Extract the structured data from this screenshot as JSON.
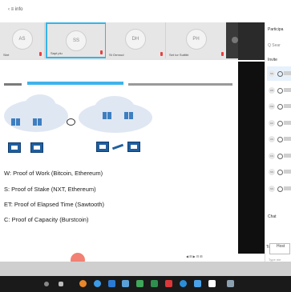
{
  "topbar": {
    "label": "‹ ≡ info"
  },
  "strip": {
    "tiles": [
      {
        "initials": "AS",
        "name": "Sbrt"
      },
      {
        "initials": "SS",
        "name": "Sapt plu"
      },
      {
        "initials": "DH",
        "name": "St Ormrud"
      },
      {
        "initials": "PH",
        "name": "Set Ior Suttlbt"
      }
    ]
  },
  "slide": {
    "lines": [
      "W: Proof of Work (Bitcoin, Ethereum)",
      "S: Proof of Stake (NXT, Ethereum)",
      "ET: Proof of Elapsed Time (Sawtooth)",
      "C: Proof of Capacity (Burstcoin)"
    ]
  },
  "panel": {
    "title": "Participa",
    "search": "Q Sear",
    "section": "Invite",
    "rows": [
      "SS",
      "LW",
      "AW",
      "AC",
      "AS",
      "KS",
      "SS",
      "SS"
    ],
    "chat_label": "Chat",
    "chat_to": "To",
    "chat_host": "Host",
    "chat_placeholder": "Type me"
  },
  "bottom": {
    "controls_text": "◀  ⊞  ▶  ⊟  ⊞"
  }
}
